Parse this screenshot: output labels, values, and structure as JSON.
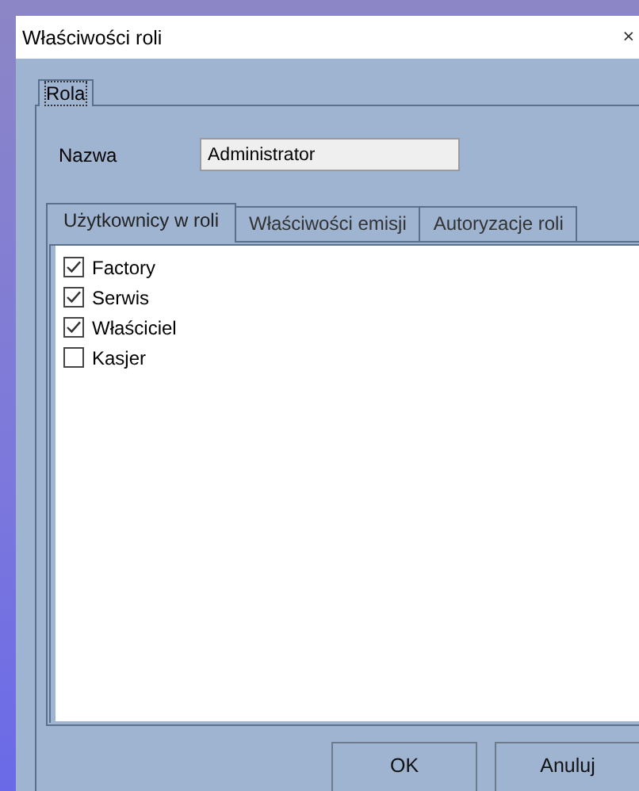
{
  "window": {
    "title": "Właściwości roli",
    "close": "×"
  },
  "tabs": [
    {
      "label": "Rola",
      "selected": true
    }
  ],
  "name_field": {
    "label": "Nazwa",
    "value": "Administrator"
  },
  "inner_tabs": [
    {
      "label": "Użytkownicy w roli",
      "selected": true
    },
    {
      "label": "Właściwości emisji",
      "selected": false
    },
    {
      "label": "Autoryzacje roli",
      "selected": false
    }
  ],
  "users": [
    {
      "label": "Factory",
      "checked": true
    },
    {
      "label": "Serwis",
      "checked": true
    },
    {
      "label": "Właściciel",
      "checked": true
    },
    {
      "label": "Kasjer",
      "checked": false
    }
  ],
  "buttons": [
    {
      "label": "OK"
    },
    {
      "label": "Anuluj"
    }
  ]
}
